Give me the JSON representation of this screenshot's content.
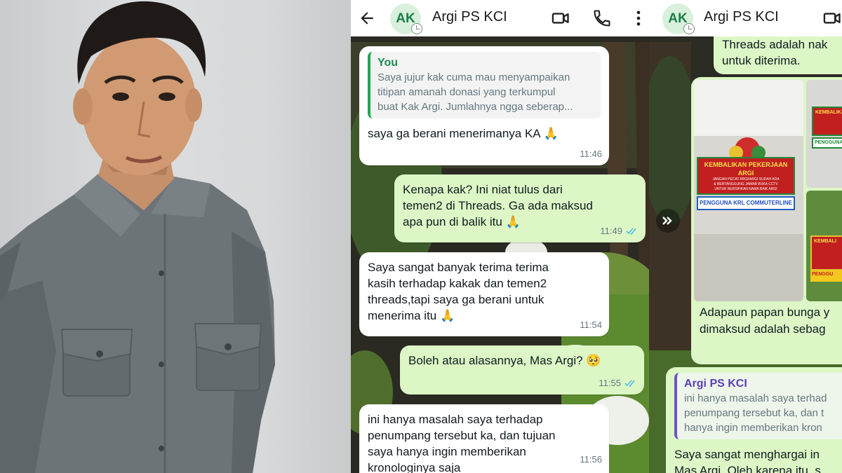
{
  "colors": {
    "accent_green": "#1fa855",
    "incoming_bubble": "#ffffff",
    "outgoing_bubble": "#dcf7c5",
    "read_ticks": "#53bdeb",
    "shirt_gray": "#6d7478"
  },
  "photo": {
    "subject": "man-portrait-icon"
  },
  "chat_left": {
    "contact": {
      "initials": "AK",
      "name": "Argi PS KCI"
    },
    "icons": [
      "back-arrow-icon",
      "video-call-icon",
      "phone-icon",
      "more-vert-icon"
    ],
    "messages": [
      {
        "direction": "in",
        "quote_author": "You",
        "quote_lines": [
          "Saya jujur kak cuma mau menyampaikan",
          "titipan amanah donasi yang terkumpul",
          "buat Kak Argi. Jumlahnya ngga seberap..."
        ],
        "text": "saya ga berani menerimanya KA",
        "emoji": "🙏",
        "time": "11:46"
      },
      {
        "direction": "out",
        "lines": [
          "Kenapa kak? Ini niat tulus dari",
          "temen2 di Threads. Ga ada maksud",
          "apa pun di balik itu"
        ],
        "emoji": "🙏",
        "time": "11:49",
        "status": "read"
      },
      {
        "direction": "in",
        "lines": [
          "Saya sangat banyak terima terima",
          "kasih terhadap kakak dan temen2",
          "threads,tapi saya ga berani untuk",
          "menerima itu"
        ],
        "emoji": "🙏",
        "time": "11:54"
      },
      {
        "direction": "out",
        "text": "Boleh atau alasannya, Mas Argi?",
        "emoji": "🥺",
        "time": "11:55",
        "status": "read"
      },
      {
        "direction": "in",
        "lines": [
          "ini hanya masalah saya terhadap",
          "penumpang tersebut ka, dan tujuan",
          "saya hanya ingin memberikan",
          "kronologinya saja"
        ],
        "time": "11:56"
      }
    ]
  },
  "chat_right": {
    "contact": {
      "initials": "AK",
      "name": "Argi PS KCI"
    },
    "icons": [
      "video-call-icon"
    ],
    "top_bubble_lines": [
      "Threads adalah nak",
      "untuk diterima."
    ],
    "image_banner": {
      "headline": "KEMBALIKAN PEKERJAAN ARGI",
      "sub_lines": [
        "JANGAN PECAT ARGI/ARGI SUDAH ADA",
        "& BERTANGGUNG JAWAB BUKA CCTV",
        "UNTUK BERSIHKAN NAMA BAIK ARGI"
      ],
      "sender": "PENGGUNA KRL COMMUTERLINE"
    },
    "image_banner_side": {
      "headline": "KEMBALIKAN",
      "sender": "PENGGUNA"
    },
    "image_banner_side2": {
      "headline": "KEMBALI",
      "sender": "PENGGU"
    },
    "image_caption_lines": [
      "Adapaun papan bunga y",
      "dimaksud adalah sebag"
    ],
    "quoted_reply": {
      "quote_author": "Argi PS KCI",
      "quote_lines": [
        "ini hanya masalah saya terhad",
        "penumpang tersebut ka, dan t",
        "hanya ingin memberikan kron"
      ],
      "lines": [
        "Saya sangat menghargai in",
        "Mas Argi. Oleh karena itu, s"
      ]
    }
  }
}
